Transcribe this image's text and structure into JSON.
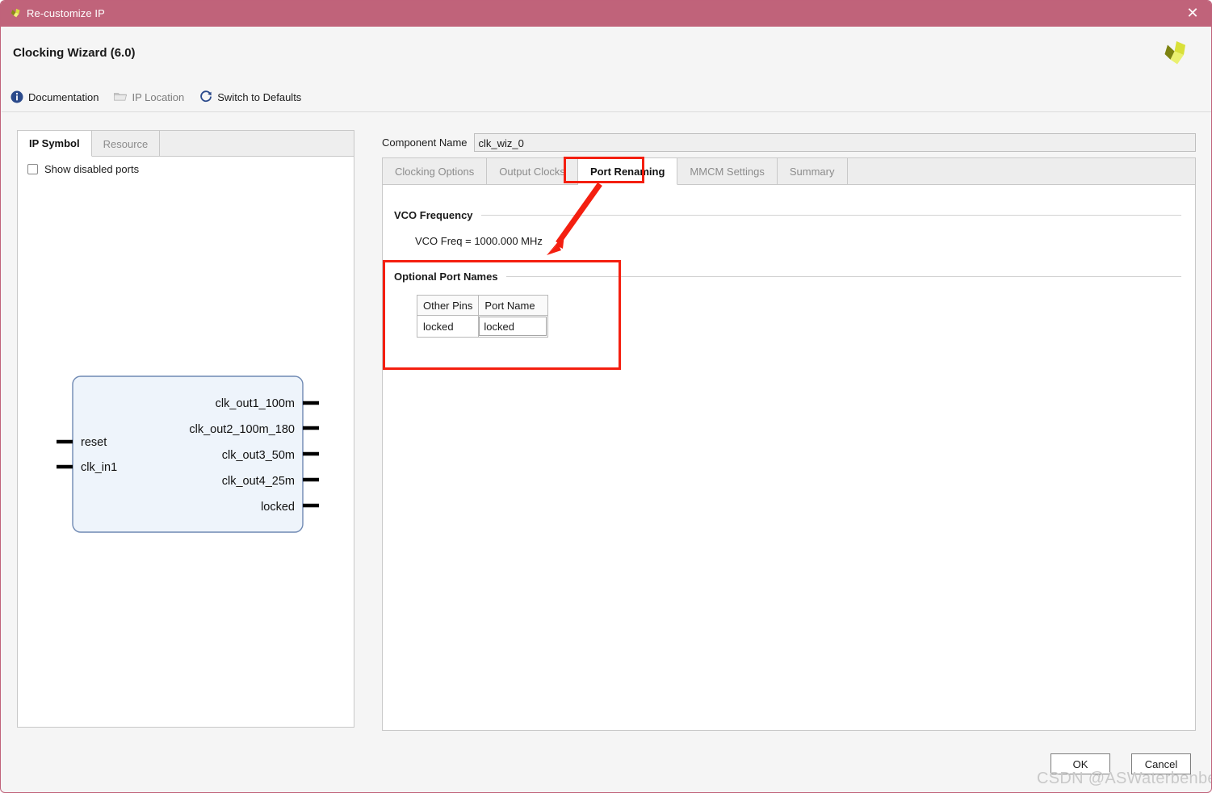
{
  "window": {
    "title": "Re-customize IP",
    "titlebar_color": "#c0637a",
    "close_label": "✕",
    "app_icon": "xilinx-pinwheel-icon"
  },
  "header": {
    "ip_title": "Clocking Wizard (6.0)",
    "logo": "xilinx-logo",
    "toolbar": [
      {
        "label": "Documentation",
        "icon": "info-icon",
        "enabled": true
      },
      {
        "label": "IP Location",
        "icon": "folder-icon",
        "enabled": false
      },
      {
        "label": "Switch to Defaults",
        "icon": "refresh-icon",
        "enabled": true
      }
    ]
  },
  "left_panel": {
    "tabs": [
      {
        "label": "IP Symbol",
        "active": true
      },
      {
        "label": "Resource",
        "active": false
      }
    ],
    "show_disabled_ports": {
      "label": "Show disabled ports",
      "checked": false
    },
    "symbol": {
      "inputs": [
        "reset",
        "clk_in1"
      ],
      "outputs": [
        "clk_out1_100m",
        "clk_out2_100m_180",
        "clk_out3_50m",
        "clk_out4_25m",
        "locked"
      ]
    }
  },
  "right_panel": {
    "component_name": {
      "label": "Component Name",
      "value": "clk_wiz_0"
    },
    "tabs": [
      {
        "label": "Clocking Options",
        "active": false
      },
      {
        "label": "Output Clocks",
        "active": false
      },
      {
        "label": "Port Renaming",
        "active": true
      },
      {
        "label": "MMCM Settings",
        "active": false
      },
      {
        "label": "Summary",
        "active": false
      }
    ],
    "vco_section": {
      "title": "VCO Frequency",
      "value": "VCO Freq = 1000.000 MHz"
    },
    "optional_ports_section": {
      "title": "Optional Port Names",
      "columns": [
        "Other Pins",
        "Port Name"
      ],
      "rows": [
        {
          "other_pin": "locked",
          "port_name": "locked"
        }
      ]
    }
  },
  "footer": {
    "ok_label": "OK",
    "cancel_label": "Cancel"
  },
  "annotations": {
    "highlight_color": "#f41f10",
    "boxes": [
      "port-renaming-tab",
      "optional-port-names-group"
    ],
    "arrow": "tab-to-group-arrow"
  },
  "watermark": {
    "text": "CSDN @ASWaterbenben"
  }
}
